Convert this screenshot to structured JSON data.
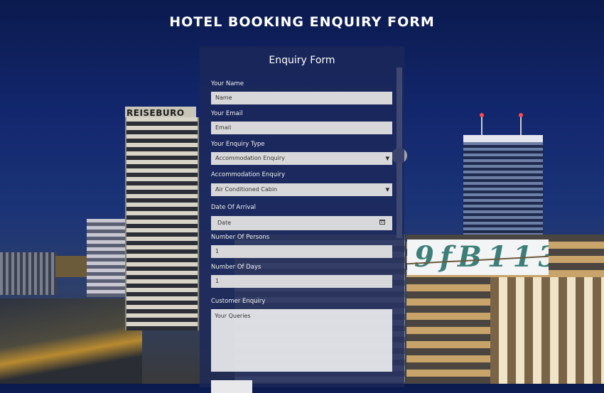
{
  "page": {
    "title": "HOTEL BOOKING ENQUIRY FORM"
  },
  "background": {
    "sign_text": "REISEBURO"
  },
  "form": {
    "title": "Enquiry Form",
    "name": {
      "label": "Your Name",
      "placeholder": "Name"
    },
    "email": {
      "label": "Your Email",
      "placeholder": "Email"
    },
    "enquiry_type": {
      "label": "Your Enquiry Type",
      "selected": "Accommodation Enquiry"
    },
    "accommodation": {
      "label": "Accommodation Enquiry",
      "selected": "Air Conditioned Cabin"
    },
    "arrival_date": {
      "label": "Date Of Arrival",
      "placeholder": "Date"
    },
    "persons": {
      "label": "Number Of Persons",
      "value": "1"
    },
    "days": {
      "label": "Number Of Days",
      "value": "1"
    },
    "customer_enquiry": {
      "label": "Customer Enquiry",
      "placeholder": "Your Queries"
    }
  },
  "captcha": {
    "text": "9fB113"
  },
  "icons": {
    "select_caret": "caret-down-icon",
    "calendar": "calendar-icon"
  },
  "colors": {
    "panel_bg": "#1c2858",
    "field_bg": "#d8d8da",
    "captcha_ink": "#3d7f78"
  }
}
